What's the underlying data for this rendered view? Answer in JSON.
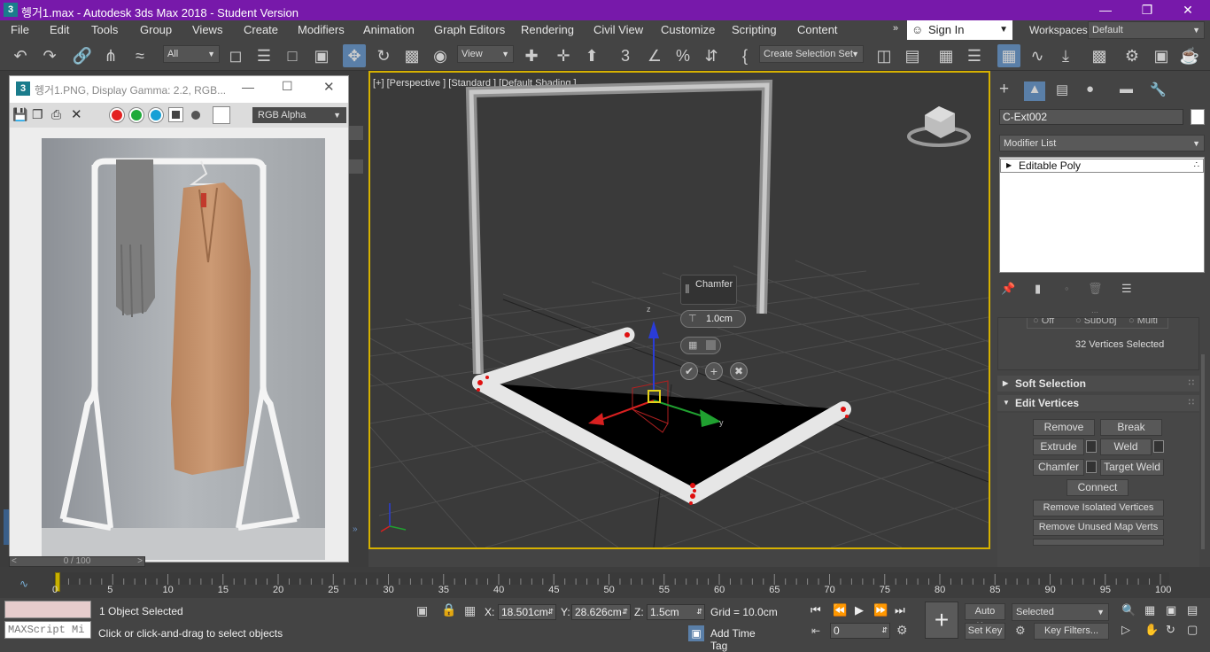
{
  "window": {
    "title": "헹거1.max - Autodesk 3ds Max 2018 - Student Version",
    "logo": "3"
  },
  "menu": [
    "File",
    "Edit",
    "Tools",
    "Group",
    "Views",
    "Create",
    "Modifiers",
    "Animation",
    "Graph Editors",
    "Rendering",
    "Civil View",
    "Customize",
    "Scripting",
    "Content"
  ],
  "user": {
    "sign_in": "Sign In",
    "workspaces_label": "Workspaces:",
    "workspace": "Default"
  },
  "toolbar": {
    "filter": "All",
    "view": "View",
    "selection_set": "Create Selection Set"
  },
  "image_window": {
    "title": "헹거1.PNG, Display Gamma: 2.2, RGB...",
    "channel": "RGB Alpha",
    "frame": "0 / 100"
  },
  "viewport": {
    "label": "[+] [Perspective ] [Standard ] [Default Shading ]",
    "chamfer_title": "Chamfer",
    "chamfer_value": "1.0cm",
    "axis_x": "x",
    "axis_y": "y",
    "axis_z": "z"
  },
  "command_panel": {
    "object_name": "C-Ext002",
    "modifier_list": "Modifier List",
    "stack_item": "Editable Poly",
    "partial_row": [
      "Off",
      "SubObj",
      "Multi"
    ],
    "selection_info": "32 Vertices Selected",
    "soft_selection": "Soft Selection",
    "edit_vertices": "Edit Vertices",
    "buttons": {
      "remove": "Remove",
      "break": "Break",
      "extrude": "Extrude",
      "weld": "Weld",
      "chamfer": "Chamfer",
      "target_weld": "Target Weld",
      "connect": "Connect",
      "remove_isolated": "Remove Isolated Vertices",
      "remove_unused": "Remove Unused Map Verts"
    }
  },
  "timeline": {
    "ticks": [
      "0",
      "5",
      "10",
      "15",
      "20",
      "25",
      "30",
      "35",
      "40",
      "45",
      "50",
      "55",
      "60",
      "65",
      "70",
      "75",
      "80",
      "85",
      "90",
      "95",
      "100"
    ]
  },
  "status": {
    "selected": "1 Object Selected",
    "prompt": "Click or click-and-drag to select objects",
    "maxscript": "MAXScript Mi",
    "x_label": "X:",
    "x": "18.501cm",
    "y_label": "Y:",
    "y": "28.626cm",
    "z_label": "Z:",
    "z": "1.5cm",
    "grid": "Grid = 10.0cm",
    "add_time_tag": "Add Time Tag",
    "auto_key": "Auto Key",
    "set_key": "Set Key",
    "key_mode": "Selected",
    "key_filters": "Key Filters...",
    "frame": "0"
  }
}
